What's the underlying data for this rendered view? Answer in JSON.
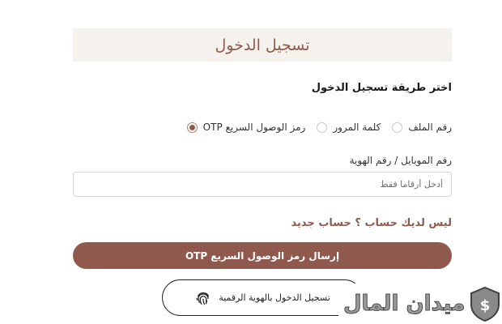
{
  "header": {
    "title": "تسجيل الدخول"
  },
  "login_method": {
    "title": "اختر طريقة تسجيل الدخول",
    "options": [
      {
        "label": "رمز الوصول السريع OTP",
        "checked": true
      },
      {
        "label": "كلمة المرور",
        "checked": false
      },
      {
        "label": "رقم الملف",
        "checked": false
      }
    ]
  },
  "id_field": {
    "label": "رقم الموبايل / رقم الهوية",
    "placeholder": "أدخل أرقاما فقط",
    "value": ""
  },
  "signup": {
    "text": "ليس لديك حساب ؟ حساب جديد"
  },
  "send_otp": {
    "label": "إرسال رمز الوصول السريع OTP"
  },
  "digital_id": {
    "label": "تسجيل الدخول بالهوية الرقمية",
    "icon": "fingerprint-icon"
  },
  "watermark": {
    "text": "ميدان المال",
    "logo_icon": "shield-dollar-icon"
  },
  "colors": {
    "accent": "#8f5a4d",
    "header_bg": "#f5f1ec",
    "border": "#d7d7d7"
  }
}
